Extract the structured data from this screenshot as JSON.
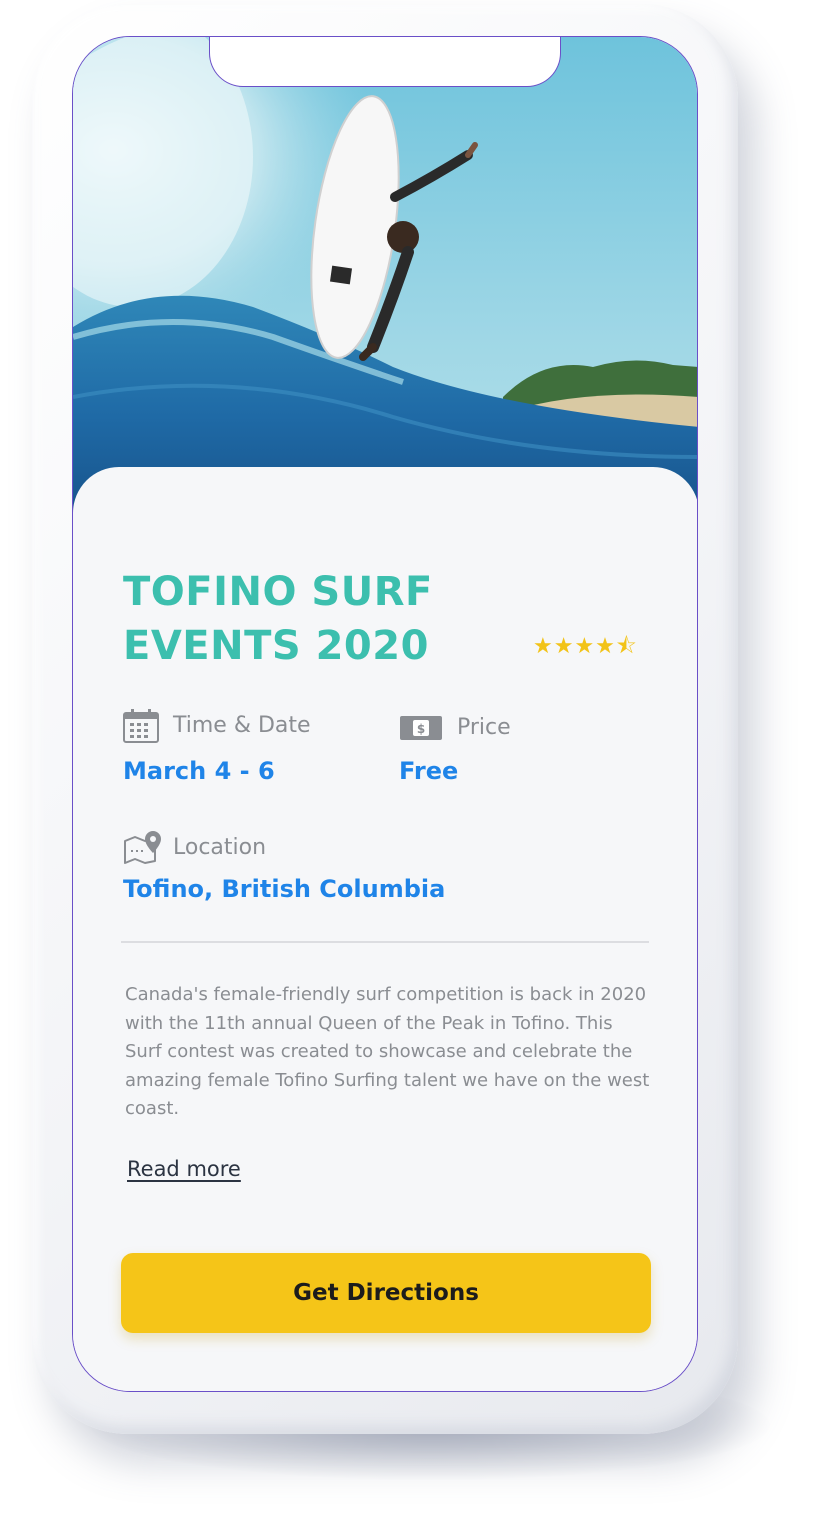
{
  "event": {
    "title": "TOFINO SURF EVENTS 2020",
    "rating_stars": "★★★★⯪",
    "rating_value": 4.5,
    "rating_max": 5
  },
  "details": {
    "time_date_label": "Time & Date",
    "time_date_value": "March 4 - 6",
    "price_label": "Price",
    "price_value": "Free",
    "location_label": "Location",
    "location_value": "Tofino, British Columbia"
  },
  "description": "Canada's female-friendly surf competition is back in 2020 with the 11th annual Queen of the Peak in Tofino. This Surf contest was created to showcase and celebrate the amazing female Tofino Surfing talent we have on the west coast.",
  "links": {
    "read_more": "Read more"
  },
  "cta": {
    "label": "Get Directions"
  },
  "colors": {
    "title": "#3cbfae",
    "value_text": "#1f84e8",
    "star": "#f2c318",
    "button": "#f5c518",
    "label_text": "#8a8d92"
  },
  "icons": {
    "calendar": "calendar-icon",
    "price": "money-icon",
    "location": "map-pin-icon"
  }
}
